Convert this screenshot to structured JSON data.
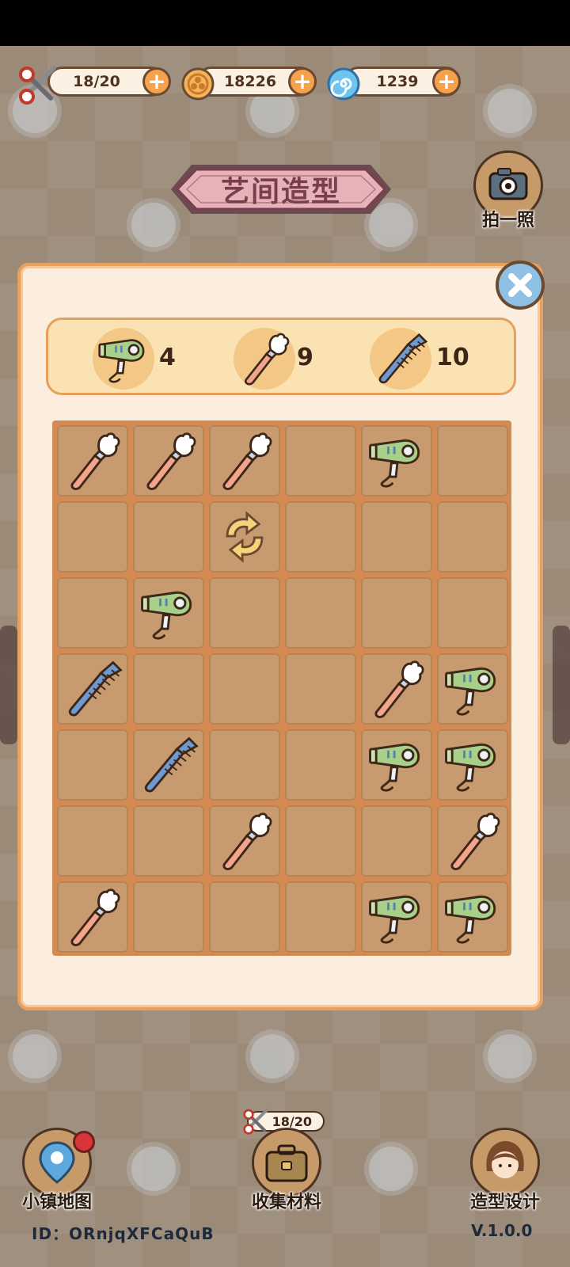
{
  "resources": [
    {
      "name": "scissors-energy",
      "value": "18/20",
      "icon": "scissors-icon"
    },
    {
      "name": "coins",
      "value": "18226",
      "icon": "coin-icon"
    },
    {
      "name": "gems",
      "value": "1239",
      "icon": "spiral-gem-icon"
    }
  ],
  "plus_label": "+",
  "title": "艺间造型",
  "camera": {
    "label": "拍一照",
    "icon": "camera-icon"
  },
  "goals": [
    {
      "item": "hair-dryer",
      "count": "4"
    },
    {
      "item": "makeup-brush",
      "count": "9"
    },
    {
      "item": "comb",
      "count": "10"
    }
  ],
  "board": {
    "rows": 7,
    "cols": 6,
    "cells": [
      [
        "brush",
        "brush",
        "brush",
        "",
        "dryer",
        ""
      ],
      [
        "",
        "",
        "refresh",
        "",
        "",
        ""
      ],
      [
        "",
        "dryer",
        "",
        "",
        "",
        ""
      ],
      [
        "comb",
        "",
        "",
        "",
        "brush",
        "dryer"
      ],
      [
        "",
        "comb",
        "",
        "",
        "dryer",
        "dryer"
      ],
      [
        "",
        "",
        "brush",
        "",
        "",
        "brush"
      ],
      [
        "brush",
        "",
        "",
        "",
        "dryer",
        "dryer"
      ]
    ]
  },
  "nav": {
    "map_label": "小镇地图",
    "collect_label": "收集材料",
    "collect_counter": "18/20",
    "design_label": "造型设计"
  },
  "footer": {
    "id_text": "ID：ORnjqXFCaQuB",
    "version": "V.1.0.0"
  },
  "colors": {
    "panel_border": "#e99f5e",
    "board_bg": "#d58a53",
    "cell_bg": "#c89a6f",
    "plus_button": "#f6a24a",
    "close_button": "#8fc0e6",
    "title_text": "#7a3f4d"
  }
}
